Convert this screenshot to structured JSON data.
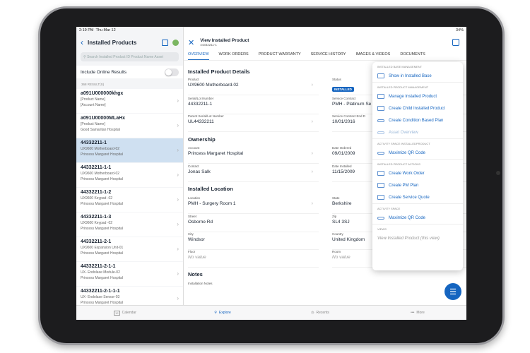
{
  "status": {
    "time": "2:19 PM",
    "date": "Thu Mar 12",
    "battery": "34%"
  },
  "left": {
    "title": "Installed Products",
    "search_placeholder": "Search Installed Product ID Product Name Asset",
    "online_label": "Include Online Results",
    "online_enabled": false,
    "count": "368 RESULT(S)",
    "items": [
      {
        "a": "a091U000000khgx",
        "b": "[Product Name]",
        "c": "[Account Name]"
      },
      {
        "a": "a091U00000MLaHx",
        "b": "[Product Name]",
        "c": "Good Samaritan Hospital"
      },
      {
        "a": "44332211-1",
        "b": "UX9600 Motherboard-02",
        "c": "Princess Margaret Hospital",
        "selected": true
      },
      {
        "a": "44332211-1-1",
        "b": "UX9600 Motherboard-02",
        "c": "Princess Margaret Hospital"
      },
      {
        "a": "44332211-1-2",
        "b": "UX9600 Keypad -02",
        "c": "Princess Margaret Hospital"
      },
      {
        "a": "44332211-1-3",
        "b": "UX9600 Keypad -02",
        "c": "Princess Margaret Hospital"
      },
      {
        "a": "44332211-2-1",
        "b": "UX9600 Expansion Unit-01",
        "c": "Princess Margaret Hospital"
      },
      {
        "a": "44332211-2-1-1",
        "b": "UX- Endolase Module-02",
        "c": "Princess Margaret Hospital"
      },
      {
        "a": "44332211-2-1-1-1",
        "b": "UX- Endolase Sensor-03",
        "c": "Princess Margaret Hospital"
      }
    ]
  },
  "right": {
    "title": "View Installed Product",
    "subtitle": "44332211-1",
    "tabs": [
      "OVERVIEW",
      "WORK ORDERS",
      "PRODUCT WARRANTY",
      "SERVICE HISTORY",
      "IMAGES & VIDEOS",
      "DOCUMENTS"
    ],
    "sections": {
      "details": "Installed Product Details",
      "ownership": "Ownership",
      "location": "Installed Location",
      "notes": "Notes"
    },
    "fields": {
      "product": {
        "l": "Product",
        "v": "UX9600 Motherboard-02"
      },
      "serial": {
        "l": "Serial/Lot Number",
        "v": "44332211-1"
      },
      "parent": {
        "l": "Parent Serial/Lot Number",
        "v": "UL44332211"
      },
      "status": {
        "l": "Status",
        "v": "INSTALLED"
      },
      "contract": {
        "l": "Service Contract",
        "v": "PMH - Platinum Se"
      },
      "contract_end": {
        "l": "Service Contract End D",
        "v": "10/01/2016"
      },
      "account": {
        "l": "Account",
        "v": "Princess Margaret Hospital"
      },
      "contact": {
        "l": "Contact",
        "v": "Jonas Salk"
      },
      "ordered": {
        "l": "Date Ordered",
        "v": "09/01/2009"
      },
      "installed": {
        "l": "Date Installed",
        "v": "11/15/2009"
      },
      "location": {
        "l": "Location",
        "v": "PMH - Surgery Room 1"
      },
      "street": {
        "l": "Street",
        "v": "Osborne Rd"
      },
      "city": {
        "l": "City",
        "v": "Windsor"
      },
      "floor": {
        "l": "Floor",
        "v": "No value"
      },
      "state": {
        "l": "State",
        "v": "Berkshire"
      },
      "zip": {
        "l": "Zip",
        "v": "SL4 3SJ"
      },
      "country": {
        "l": "Country",
        "v": "United Kingdom"
      },
      "room": {
        "l": "Room",
        "v": "No value"
      },
      "notes": {
        "l": "Installation Notes"
      }
    }
  },
  "menu": {
    "h1": "INSTALLED BASE MANAGEMENT",
    "i1": "Show in Installed Base",
    "h2": "INSTALLED PRODUCT MANAGEMENT",
    "i2": "Manage Installed Product",
    "i3": "Create Child Installed Product",
    "i4": "Create Condition Based Plan",
    "i5": "Asset Overview",
    "h3": "ACTIVITY SPACE INSTALLEDPRODUCT",
    "i6": "Maximize QR Code",
    "h4": "INSTALLED PRODUCT ACTIONS",
    "i7": "Create Work Order",
    "i8": "Create PM Plan",
    "i9": "Create Service Quote",
    "h5": "ACTIVITY SPACE",
    "i10": "Maximize QR Code",
    "h6": "VIEWS",
    "i11": "View Installed Product (this view)"
  },
  "bottom": {
    "calendar": "Calendar",
    "calendar_day": "12",
    "explore": "Explore",
    "recents": "Recents",
    "more": "More"
  },
  "colors": {
    "accent": "#1565c0",
    "selected": "#cfe0f1"
  }
}
